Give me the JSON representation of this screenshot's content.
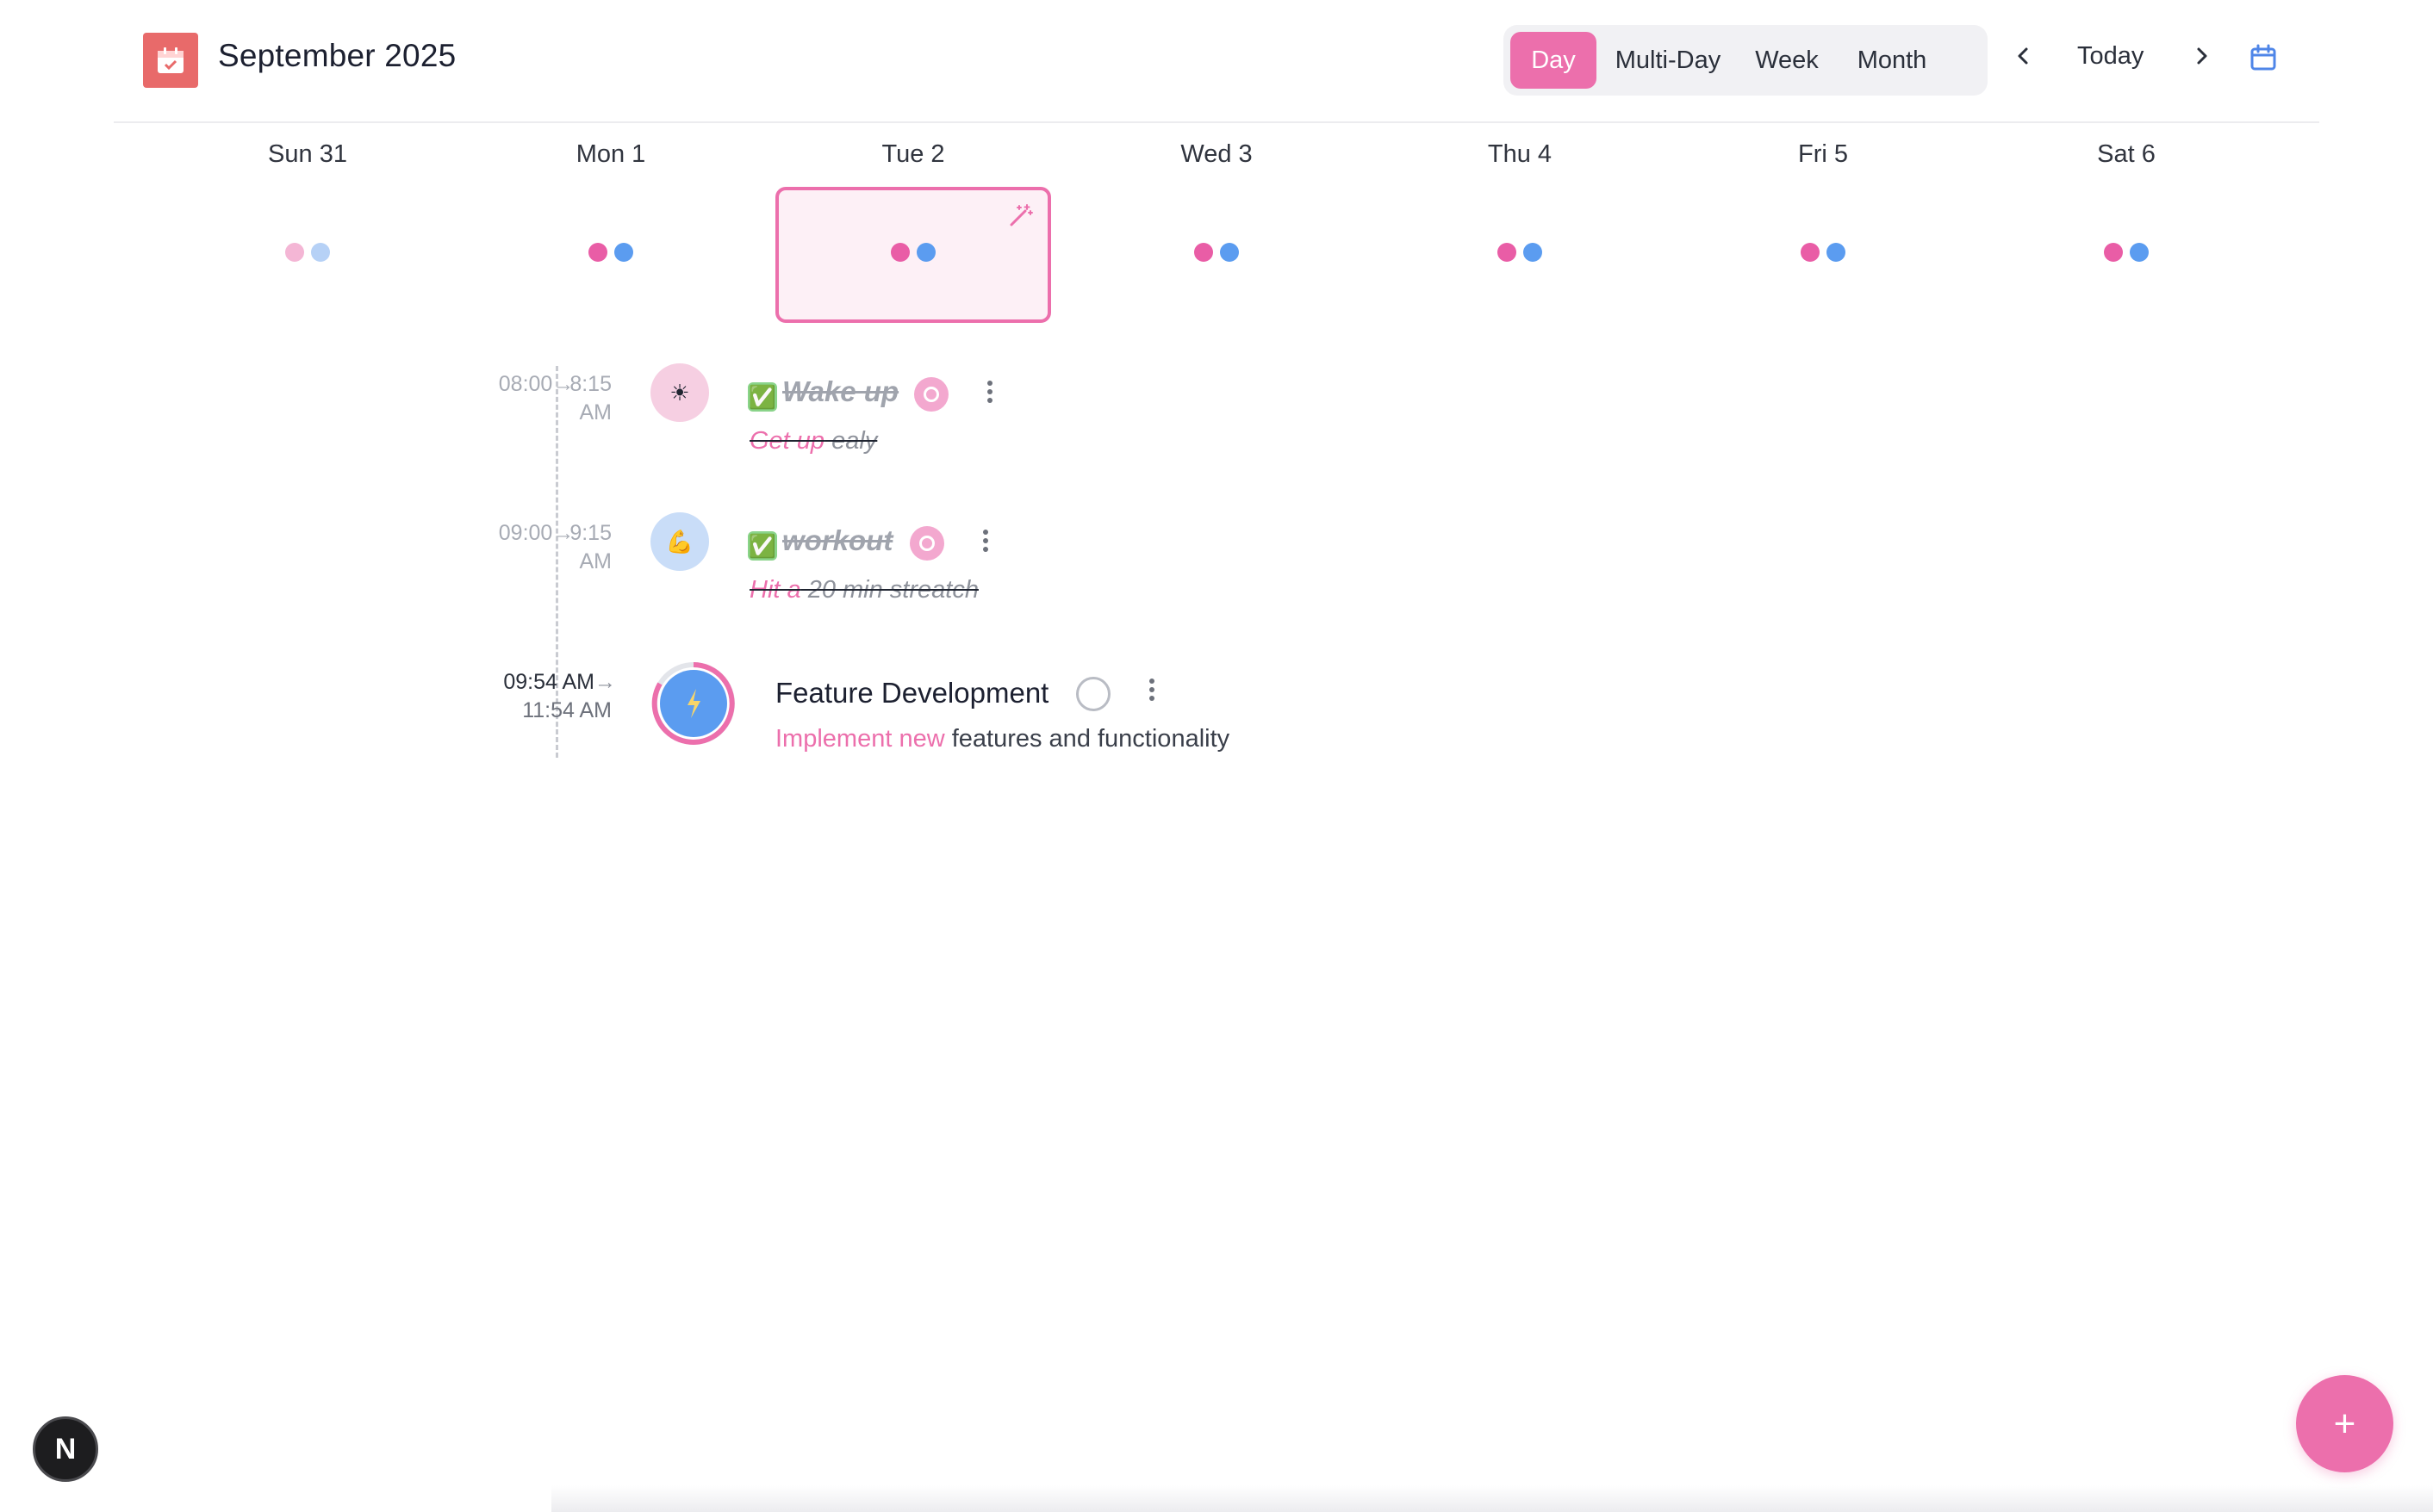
{
  "header": {
    "title": "September 2025",
    "views": [
      "Day",
      "Multi-Day",
      "Week",
      "Month"
    ],
    "active_view": "Day",
    "today_label": "Today"
  },
  "week": {
    "days": [
      "Sun 31",
      "Mon 1",
      "Tue 2",
      "Wed 3",
      "Thu 4",
      "Fri 5",
      "Sat 6"
    ],
    "selected": "Tue 2"
  },
  "events": [
    {
      "time_start": "08:00",
      "time_end_a": "8:15",
      "time_end_b": "AM",
      "icon": "sun-icon",
      "check": "✅",
      "title": "Wake up",
      "desc_highlight": "Get up",
      "desc_rest": " ealy",
      "status": "done"
    },
    {
      "time_start": "09:00",
      "time_end_a": "9:15",
      "time_end_b": "AM",
      "icon": "flexed-arm-icon",
      "check": "✅",
      "title": "workout",
      "desc_highlight": "Hit a",
      "desc_rest": " 20 min streatch",
      "status": "done"
    },
    {
      "time_start": "09:54 AM",
      "time_end": "11:54 AM",
      "icon": "lightning-icon",
      "title": "Feature Development",
      "desc_highlight": "Implement new",
      "desc_rest": " features and functionality",
      "status": "open"
    }
  ],
  "fab_label": "+",
  "badge_label": "N",
  "colors": {
    "accent": "#ec6fac",
    "secondary": "#5b9cf0",
    "logo": "#e86a6a"
  }
}
